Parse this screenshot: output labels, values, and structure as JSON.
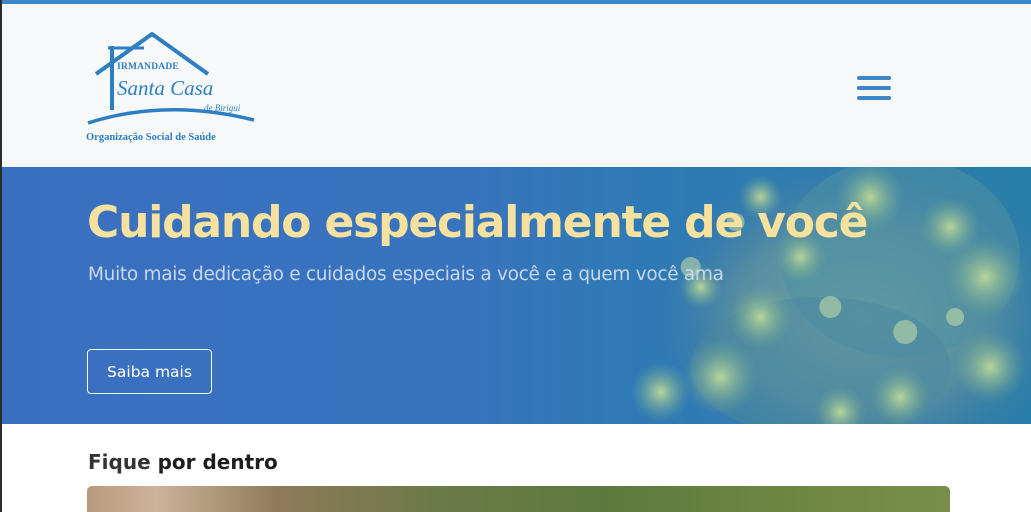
{
  "header": {
    "logo": {
      "line1": "IRMANDADE",
      "line2": "Santa Casa",
      "line3": "de Birigui",
      "line4": "Organização Social de Saúde"
    },
    "menu_icon": "hamburger-menu-icon"
  },
  "hero": {
    "title": "Cuidando especialmente de você",
    "subtitle": "Muito mais dedicação e cuidados especiais a você e a quem você ama",
    "button_label": "Saiba mais",
    "background_image": "virus-illustration"
  },
  "section": {
    "title_regular": "Fique",
    "title_bold": "por dentro"
  },
  "colors": {
    "accent_blue": "#3d86c8",
    "hero_title": "#f6e29e",
    "hero_subtitle": "#c9d7ec",
    "header_bg": "#f7f8fa"
  }
}
